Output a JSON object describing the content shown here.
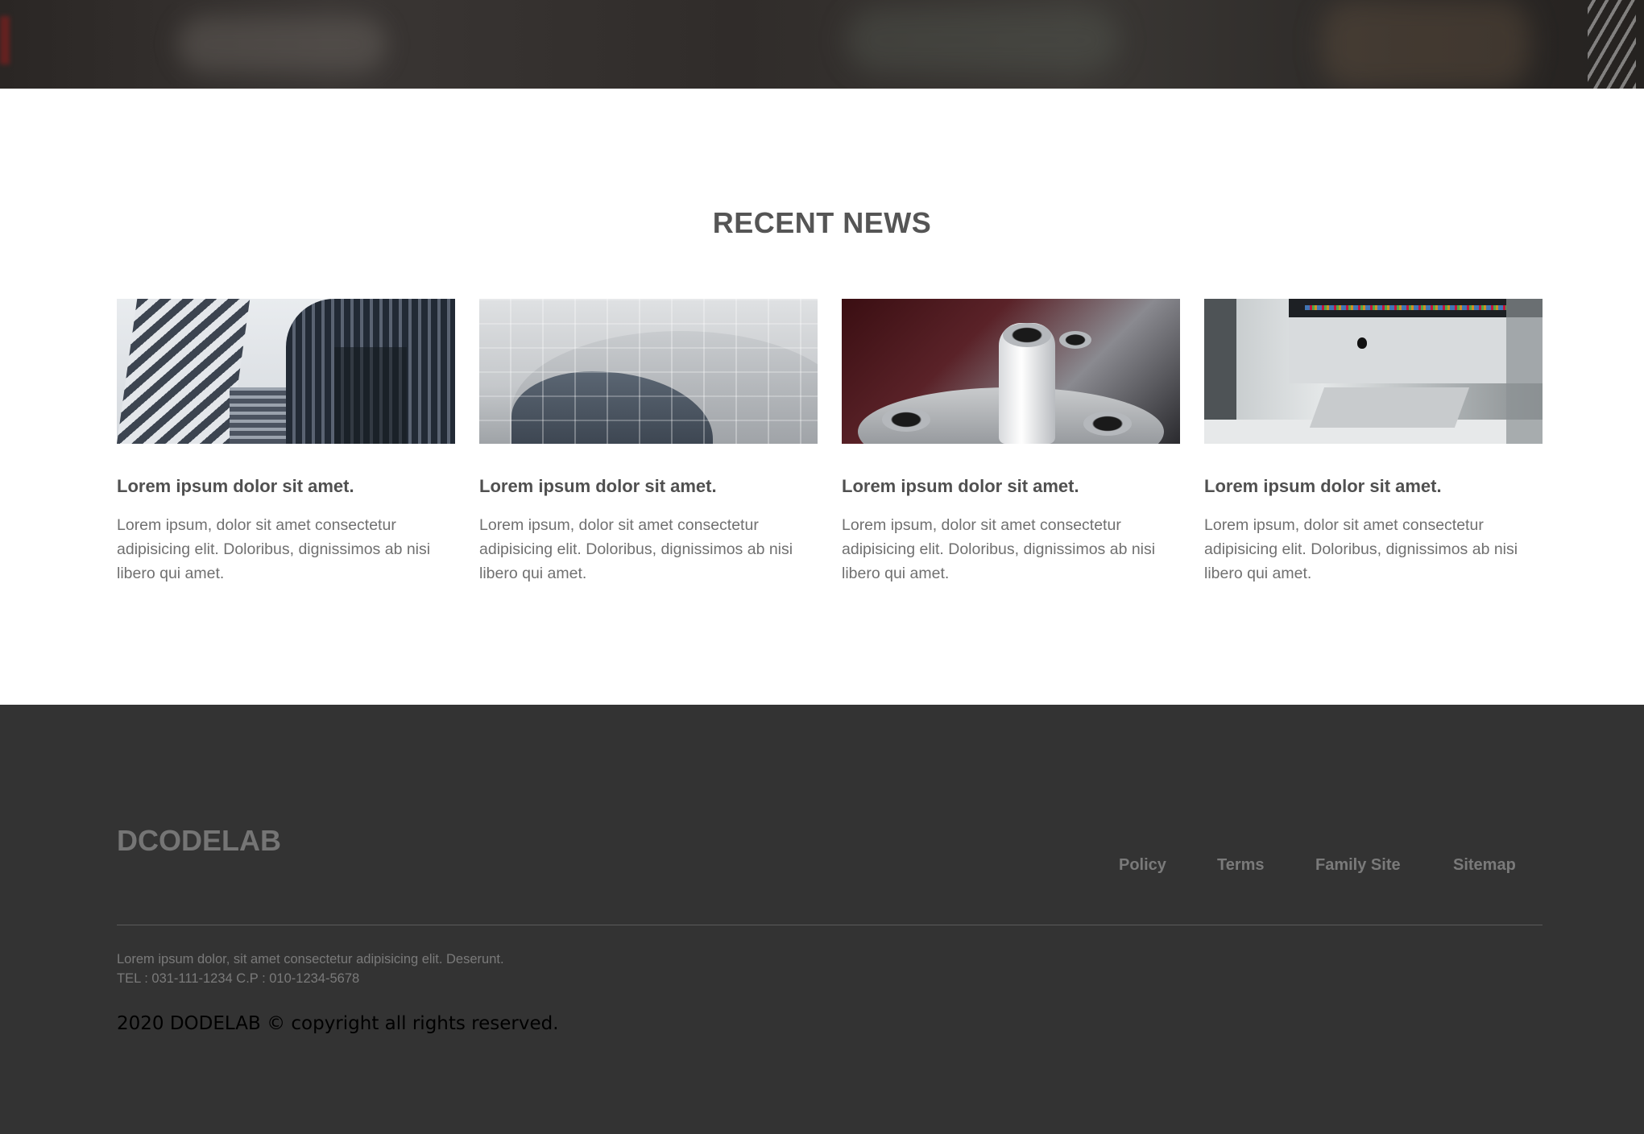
{
  "news": {
    "title": "RECENT NEWS",
    "cards": [
      {
        "image": "office-buildings-photo",
        "headline": "Lorem ipsum dolor sit amet.",
        "text": "Lorem ipsum, dolor sit amet consectetur adipisicing elit. Doloribus, dignissimos ab nisi libero qui amet."
      },
      {
        "image": "curved-metal-facade-photo",
        "headline": "Lorem ipsum dolor sit amet.",
        "text": "Lorem ipsum, dolor sit amet consectetur adipisicing elit. Doloribus, dignissimos ab nisi libero qui amet."
      },
      {
        "image": "bottles-in-ice-bucket-photo",
        "headline": "Lorem ipsum dolor sit amet.",
        "text": "Lorem ipsum, dolor sit amet consectetur adipisicing elit. Doloribus, dignissimos ab nisi libero qui amet."
      },
      {
        "image": "imac-on-desk-photo",
        "headline": "Lorem ipsum dolor sit amet.",
        "text": "Lorem ipsum, dolor sit amet consectetur adipisicing elit. Doloribus, dignissimos ab nisi libero qui amet."
      }
    ]
  },
  "footer": {
    "logo": "DCODELAB",
    "nav": [
      "Policy",
      "Terms",
      "Family Site",
      "Sitemap"
    ],
    "address": "Lorem ipsum dolor, sit amet consectetur adipisicing elit. Deserunt.",
    "phone": "TEL : 031-111-1234 C.P : 010-1234-5678",
    "copyright": "2020 DODELAB © copyright all rights reserved."
  },
  "colors": {
    "footer_bg": "#333333",
    "title_text": "#555555",
    "body_text": "#707070"
  }
}
